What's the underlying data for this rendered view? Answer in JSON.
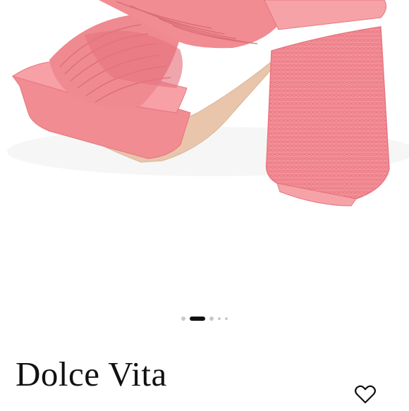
{
  "product": {
    "brand": "Dolce Vita",
    "image_subject": "pink-platform-sandal-photo",
    "colors": {
      "shoe": "#f08c92",
      "shoe_dark": "#e7747f",
      "sole": "#e9c6ab",
      "heel": "#f38f97"
    }
  },
  "gallery": {
    "total_images": 5,
    "active_index": 1
  },
  "actions": {
    "favorite_icon": "heart-outline-icon"
  }
}
